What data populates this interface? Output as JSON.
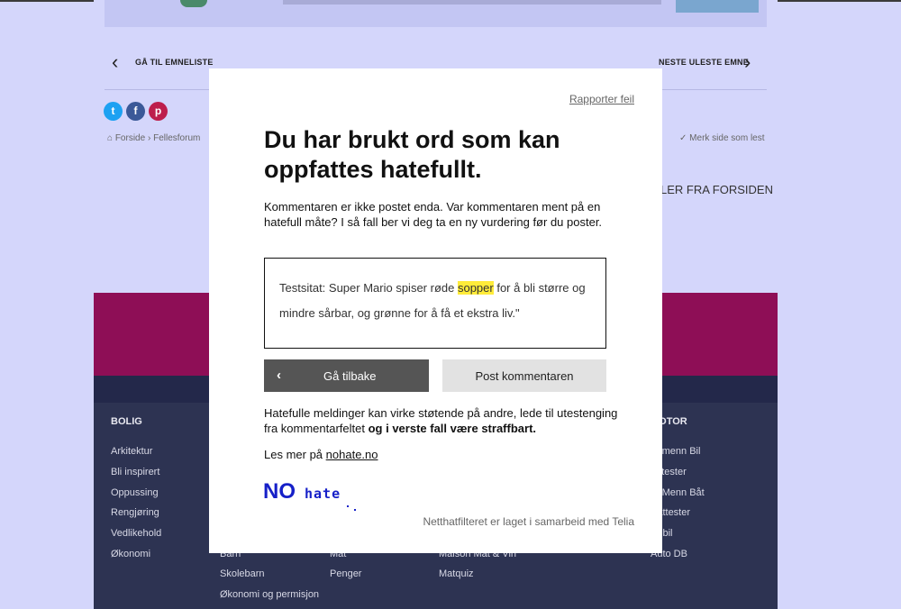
{
  "nav": {
    "back_to_topics": "GÅ TIL EMNELISTE",
    "next_unread": "NESTE ULESTE EMNE"
  },
  "breadcrumb": {
    "home": "Forside",
    "forum": "Fellesforum",
    "mark_read": "Merk side som lest"
  },
  "side_title": "LER FRA FORSIDEN",
  "footer": {
    "col1": {
      "heading": "BOLIG",
      "links": [
        "Arkitektur",
        "Bli inspirert",
        "Oppussing",
        "Rengjøring",
        "Vedlikehold",
        "Økonomi"
      ]
    },
    "col2": {
      "links": [
        "Barn",
        "Skolebarn",
        "Økonomi og permisjon"
      ]
    },
    "col3": {
      "links": [
        "Mat",
        "Penger"
      ]
    },
    "col4": {
      "links": [
        "Maison Mat & Vin",
        "Matquiz"
      ]
    },
    "col5": {
      "heading": "MOTOR",
      "links": [
        "Vi menn Bil",
        "Biltester",
        "Vi Menn Båt",
        "Båttester",
        "Bobil",
        "Auto DB"
      ]
    }
  },
  "modal": {
    "report_link": "Rapporter feil",
    "title": "Du har brukt ord som kan oppfattes hatefullt.",
    "intro": "Kommentaren er ikke postet enda. Var kommentaren ment på en hatefull måte? I så fall ber vi deg ta en ny vurdering før du poster.",
    "quote_before": "Testsitat: Super Mario spiser røde ",
    "quote_highlight": "sopper",
    "quote_after": " for å bli større og mindre sårbar, og grønne for å få et ekstra liv.\"",
    "back_button": "Gå tilbake",
    "post_button": "Post kommentaren",
    "warning_start": "Hatefulle meldinger kan virke støtende på andre, lede til utestenging fra kommentarfeltet ",
    "warning_bold": "og i verste fall være straffbart.",
    "read_more_prefix": "Les mer på ",
    "read_more_link": "nohate.no",
    "logo_no": "NO",
    "logo_hate": "hate",
    "partner": "Netthatfilteret er laget i samarbeid med Telia"
  },
  "colors": {
    "accent_magenta": "#8e0e56",
    "footer_navy": "#2d3352",
    "highlight": "#ffec3a",
    "logo_blue": "#1620c8"
  },
  "icons": [
    "chevron-left-icon",
    "chevron-right-icon",
    "twitter-icon",
    "facebook-icon",
    "pinterest-icon",
    "home-icon",
    "check-icon"
  ]
}
